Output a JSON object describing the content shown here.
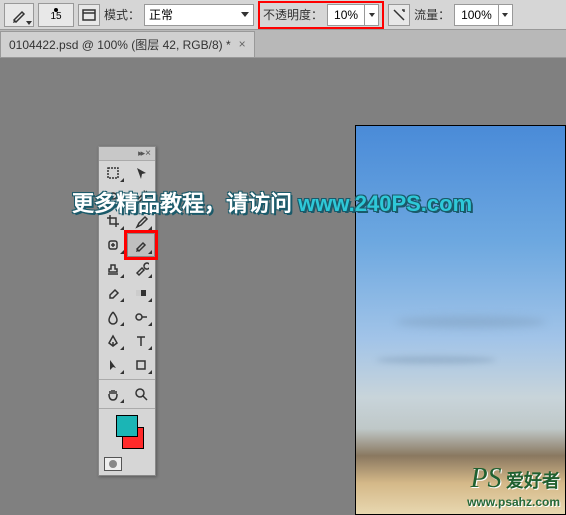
{
  "options_bar": {
    "brush_size": "15",
    "mode_label": "模式：",
    "mode_value": "正常",
    "opacity_label": "不透明度：",
    "opacity_value": "10%",
    "flow_label": "流量：",
    "flow_value": "100%"
  },
  "tab": {
    "title": "0104422.psd @ 100% (图层 42, RGB/8) *",
    "close": "×"
  },
  "overlay": {
    "text": "更多精品教程，请访问 ",
    "url": "www.240PS.com"
  },
  "watermark": {
    "logo": "PS",
    "cn": "爱好者",
    "url": "www.psahz.com"
  },
  "colors": {
    "foreground": "#1bb5b5",
    "background": "#ff2a2a"
  },
  "tools": [
    {
      "name": "marquee-icon"
    },
    {
      "name": "move-icon"
    },
    {
      "name": "lasso-icon"
    },
    {
      "name": "quick-select-icon"
    },
    {
      "name": "crop-icon"
    },
    {
      "name": "eyedropper-icon"
    },
    {
      "name": "healing-icon"
    },
    {
      "name": "brush-icon"
    },
    {
      "name": "stamp-icon"
    },
    {
      "name": "history-brush-icon"
    },
    {
      "name": "eraser-icon"
    },
    {
      "name": "gradient-icon"
    },
    {
      "name": "blur-icon"
    },
    {
      "name": "dodge-icon"
    },
    {
      "name": "pen-icon"
    },
    {
      "name": "type-icon"
    },
    {
      "name": "path-select-icon"
    },
    {
      "name": "shape-icon"
    },
    {
      "name": "hand-icon"
    },
    {
      "name": "zoom-icon"
    }
  ]
}
